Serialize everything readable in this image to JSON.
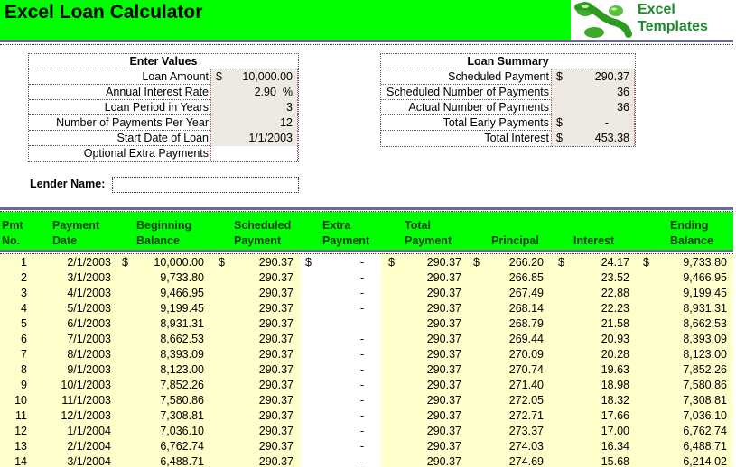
{
  "header": {
    "title": "Excel Loan Calculator",
    "logo_line1": "Excel",
    "logo_line2": "Templates",
    "accent_color": "#00ff00"
  },
  "enter_values": {
    "heading": "Enter Values",
    "rows": [
      {
        "label": "Loan Amount",
        "currency": "$",
        "value": "10,000.00"
      },
      {
        "label": "Annual Interest Rate",
        "currency": "",
        "value": "2.90  %"
      },
      {
        "label": "Loan Period in Years",
        "currency": "",
        "value": "3"
      },
      {
        "label": "Number of Payments Per Year",
        "currency": "",
        "value": "12"
      },
      {
        "label": "Start Date of Loan",
        "currency": "",
        "value": "1/1/2003"
      },
      {
        "label": "Optional Extra Payments",
        "currency": "",
        "value": ""
      }
    ]
  },
  "loan_summary": {
    "heading": "Loan Summary",
    "rows": [
      {
        "label": "Scheduled Payment",
        "currency": "$",
        "value": "290.37"
      },
      {
        "label": "Scheduled Number of Payments",
        "currency": "",
        "value": "36"
      },
      {
        "label": "Actual Number of Payments",
        "currency": "",
        "value": "36"
      },
      {
        "label": "Total Early Payments",
        "currency": "$",
        "value": "-"
      },
      {
        "label": "Total Interest",
        "currency": "$",
        "value": "453.38"
      }
    ]
  },
  "lender": {
    "label": "Lender Name:",
    "value": ""
  },
  "schedule": {
    "headers": [
      {
        "line1": "Pmt",
        "line2": "No."
      },
      {
        "line1": "Payment",
        "line2": "Date"
      },
      {
        "line1": "Beginning",
        "line2": "Balance"
      },
      {
        "line1": "Scheduled",
        "line2": "Payment"
      },
      {
        "line1": "Extra",
        "line2": "Payment"
      },
      {
        "line1": "Total",
        "line2": "Payment"
      },
      {
        "line1": "",
        "line2": "Principal"
      },
      {
        "line1": "",
        "line2": "Interest"
      },
      {
        "line1": "Ending",
        "line2": "Balance"
      }
    ],
    "currency_symbol": "$",
    "rows": [
      {
        "no": "1",
        "date": "2/1/2003",
        "begin": "10,000.00",
        "sched": "290.37",
        "extra": "-",
        "total": "290.37",
        "principal": "266.20",
        "interest": "24.17",
        "end": "9,733.80"
      },
      {
        "no": "2",
        "date": "3/1/2003",
        "begin": "9,733.80",
        "sched": "290.37",
        "extra": "-",
        "total": "290.37",
        "principal": "266.85",
        "interest": "23.52",
        "end": "9,466.95"
      },
      {
        "no": "3",
        "date": "4/1/2003",
        "begin": "9,466.95",
        "sched": "290.37",
        "extra": "-",
        "total": "290.37",
        "principal": "267.49",
        "interest": "22.88",
        "end": "9,199.45"
      },
      {
        "no": "4",
        "date": "5/1/2003",
        "begin": "9,199.45",
        "sched": "290.37",
        "extra": "-",
        "total": "290.37",
        "principal": "268.14",
        "interest": "22.23",
        "end": "8,931.31"
      },
      {
        "no": "5",
        "date": "6/1/2003",
        "begin": "8,931.31",
        "sched": "290.37",
        "extra": "",
        "total": "290.37",
        "principal": "268.79",
        "interest": "21.58",
        "end": "8,662.53"
      },
      {
        "no": "6",
        "date": "7/1/2003",
        "begin": "8,662.53",
        "sched": "290.37",
        "extra": "-",
        "total": "290.37",
        "principal": "269.44",
        "interest": "20.93",
        "end": "8,393.09"
      },
      {
        "no": "7",
        "date": "8/1/2003",
        "begin": "8,393.09",
        "sched": "290.37",
        "extra": "-",
        "total": "290.37",
        "principal": "270.09",
        "interest": "20.28",
        "end": "8,123.00"
      },
      {
        "no": "8",
        "date": "9/1/2003",
        "begin": "8,123.00",
        "sched": "290.37",
        "extra": "-",
        "total": "290.37",
        "principal": "270.74",
        "interest": "19.63",
        "end": "7,852.26"
      },
      {
        "no": "9",
        "date": "10/1/2003",
        "begin": "7,852.26",
        "sched": "290.37",
        "extra": "-",
        "total": "290.37",
        "principal": "271.40",
        "interest": "18.98",
        "end": "7,580.86"
      },
      {
        "no": "10",
        "date": "11/1/2003",
        "begin": "7,580.86",
        "sched": "290.37",
        "extra": "-",
        "total": "290.37",
        "principal": "272.05",
        "interest": "18.32",
        "end": "7,308.81"
      },
      {
        "no": "11",
        "date": "12/1/2003",
        "begin": "7,308.81",
        "sched": "290.37",
        "extra": "-",
        "total": "290.37",
        "principal": "272.71",
        "interest": "17.66",
        "end": "7,036.10"
      },
      {
        "no": "12",
        "date": "1/1/2004",
        "begin": "7,036.10",
        "sched": "290.37",
        "extra": "-",
        "total": "290.37",
        "principal": "273.37",
        "interest": "17.00",
        "end": "6,762.74"
      },
      {
        "no": "13",
        "date": "2/1/2004",
        "begin": "6,762.74",
        "sched": "290.37",
        "extra": "-",
        "total": "290.37",
        "principal": "274.03",
        "interest": "16.34",
        "end": "6,488.71"
      },
      {
        "no": "14",
        "date": "3/1/2004",
        "begin": "6,488.71",
        "sched": "290.37",
        "extra": "-",
        "total": "290.37",
        "principal": "274.69",
        "interest": "15.68",
        "end": "6,214.02"
      }
    ]
  }
}
